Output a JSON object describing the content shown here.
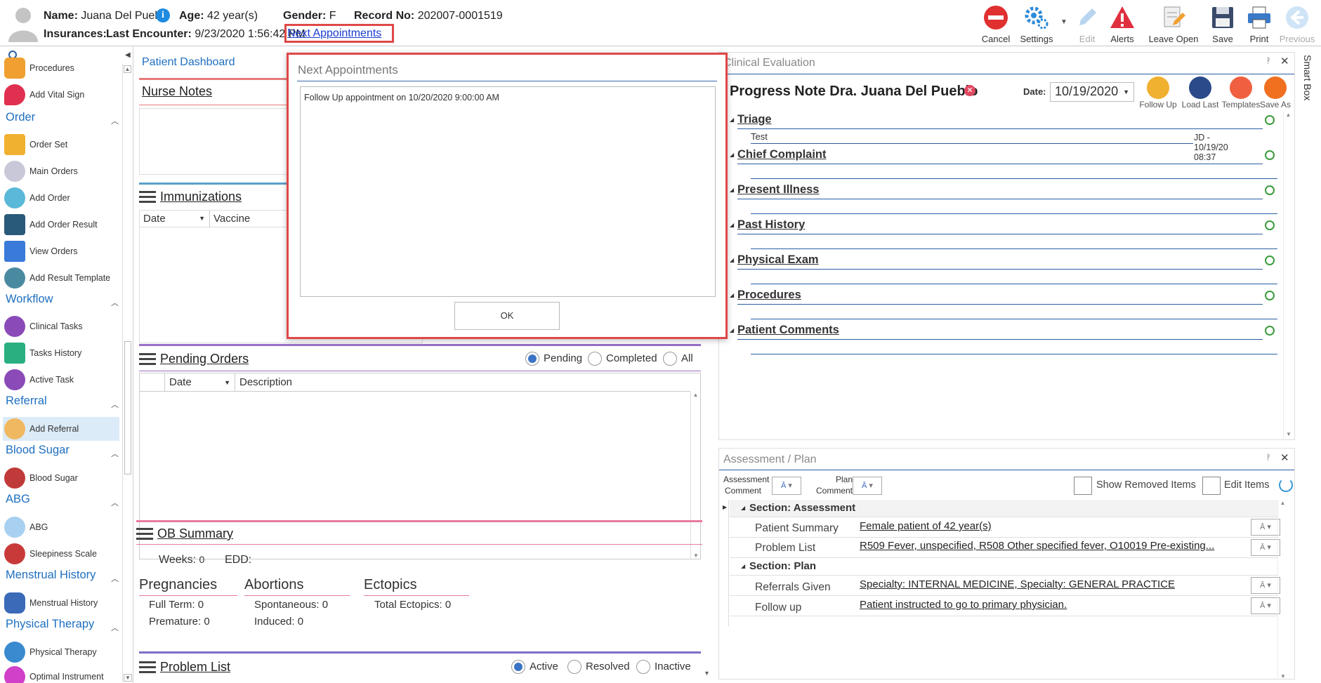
{
  "header": {
    "name_label": "Name:",
    "name_value": "Juana Del Pueblo",
    "age_label": "Age:",
    "age_value": "42 year(s)",
    "gender_label": "Gender:",
    "gender_value": "F",
    "record_label": "Record No:",
    "record_value": "202007-0001519",
    "insurances_label": "Insurances:",
    "last_encounter_label": "Last Encounter:",
    "last_encounter_value": "9/23/2020 1:56:42 PM",
    "next_appointments_link": "Next Appointments"
  },
  "toolbar": {
    "cancel": "Cancel",
    "settings": "Settings",
    "edit": "Edit",
    "alerts": "Alerts",
    "leave_open": "Leave Open",
    "save": "Save",
    "print": "Print",
    "previous": "Previous"
  },
  "sidebar": {
    "procedures": "Procedures",
    "add_vital_sign": "Add Vital Sign",
    "order_header": "Order",
    "order_set": "Order Set",
    "main_orders": "Main Orders",
    "add_order": "Add Order",
    "add_order_result": "Add Order Result",
    "view_orders": "View Orders",
    "add_result_template": "Add Result Template",
    "workflow_header": "Workflow",
    "clinical_tasks": "Clinical Tasks",
    "tasks_history": "Tasks History",
    "active_task": "Active Task",
    "referral_header": "Referral",
    "add_referral": "Add Referral",
    "blood_sugar_header": "Blood Sugar",
    "blood_sugar": "Blood Sugar",
    "abg_header": "ABG",
    "abg": "ABG",
    "sleepiness_scale": "Sleepiness Scale",
    "menstrual_header": "Menstrual History",
    "menstrual_history": "Menstrual History",
    "physical_therapy_header": "Physical Therapy",
    "physical_therapy": "Physical Therapy",
    "optimal_instrument": "Optimal Instrument"
  },
  "dashboard": {
    "tab": "Patient Dashboard",
    "nurse_notes": "Nurse Notes",
    "immunizations": "Immunizations",
    "imm_col_date": "Date",
    "imm_col_vaccine": "Vaccine",
    "pending_orders": "Pending Orders",
    "radio_pending": "Pending",
    "radio_completed": "Completed",
    "radio_all": "All",
    "po_col_date": "Date",
    "po_col_description": "Description",
    "ob_summary": "OB Summary",
    "weeks_label": "Weeks:",
    "weeks_value": "0",
    "edd_label": "EDD:",
    "pregnancies": "Pregnancies",
    "full_term": "Full Term: 0",
    "premature": "Premature: 0",
    "abortions": "Abortions",
    "spontaneous": "Spontaneous: 0",
    "induced": "Induced: 0",
    "ectopics": "Ectopics",
    "total_ectopics": "Total Ectopics: 0",
    "problem_list": "Problem List",
    "radio_active": "Active",
    "radio_resolved": "Resolved",
    "radio_inactive": "Inactive"
  },
  "clinical": {
    "panel_title": "Clinical Evaluation",
    "note_title": "Progress Note Dra. Juana Del Pueblo",
    "date_label": "Date:",
    "date_value": "10/19/2020",
    "follow_up": "Follow Up",
    "load_last": "Load Last",
    "templates": "Templates",
    "save_as": "Save As",
    "sections": [
      "Triage",
      "Chief Complaint",
      "Present Illness",
      "Past History",
      "Physical Exam",
      "Procedures",
      "Patient Comments"
    ],
    "triage_text": "Test",
    "triage_stamp": "JD - 10/19/20 08:37",
    "smart_box": "Smart Box"
  },
  "assessment": {
    "panel_title": "Assessment / Plan",
    "assessment_comment": "Assessment Comment",
    "plan_comment": "Plan Comment",
    "show_removed": "Show Removed Items",
    "edit_items": "Edit Items",
    "section_assessment": "Section: Assessment",
    "section_plan": "Section: Plan",
    "rows": [
      {
        "label": "Patient Summary",
        "value": "Female patient of 42 year(s)"
      },
      {
        "label": "Problem List",
        "value": "R509 Fever, unspecified, R508 Other specified fever, O10019 Pre-existing..."
      },
      {
        "label": "Referrals Given",
        "value": "Specialty: INTERNAL MEDICINE, Specialty: GENERAL PRACTICE"
      },
      {
        "label": "Follow up",
        "value": "Patient instructed to go to primary physician."
      }
    ]
  },
  "modal": {
    "title": "Next Appointments",
    "text": "Follow Up appointment on 10/20/2020 9:00:00 AM",
    "ok": "OK"
  },
  "colors": {
    "accent_blue": "#1e6fc0",
    "highlight_red": "#e04848",
    "nurse_notes_bar": "#e87a7a",
    "immunizations_bar": "#5aa0c8",
    "pending_orders_bar": "#9a6fc8",
    "ob_summary_bar": "#e87aa0",
    "problem_list_bar": "#7a6fc8"
  }
}
